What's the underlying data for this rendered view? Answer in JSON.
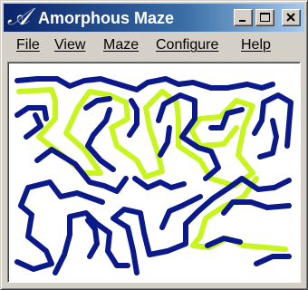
{
  "window": {
    "title": "Amorphous Maze",
    "icon": "script-a-icon",
    "icon_glyph": "𝒜"
  },
  "title_buttons": [
    "minimize",
    "maximize",
    "close"
  ],
  "menu": [
    {
      "label": "File"
    },
    {
      "label": "View"
    },
    {
      "label": "Maze"
    },
    {
      "label": "Configure"
    },
    {
      "label": "Help"
    }
  ],
  "colors": {
    "title_bar_start": "#0a246a",
    "title_bar_end": "#a6caf0",
    "maze_walls": "#0a1a8a",
    "solution_path": "#c8f520",
    "window_face": "#d4d0c8",
    "canvas_background": "#ffffff"
  }
}
